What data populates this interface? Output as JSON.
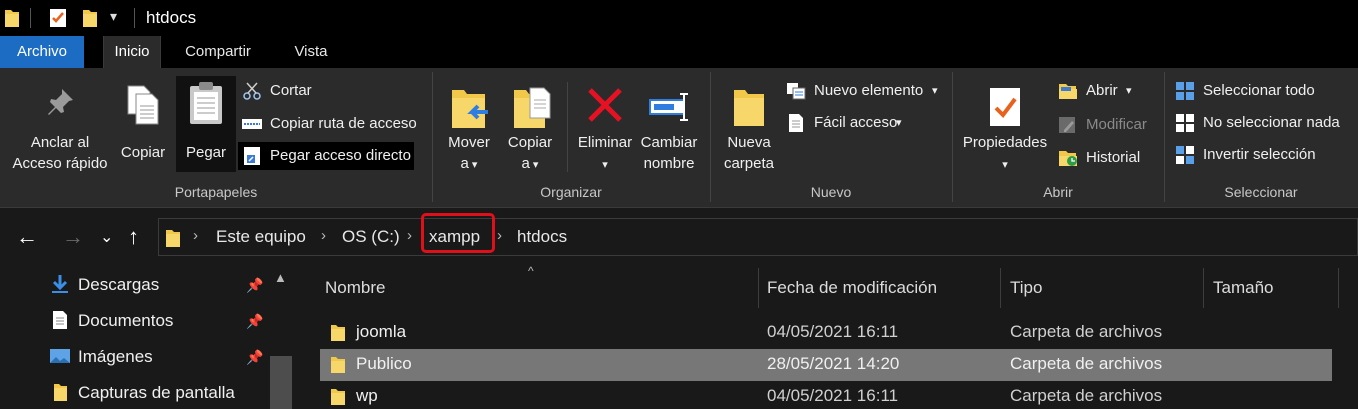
{
  "window": {
    "title": "htdocs"
  },
  "tabs": [
    {
      "label": "Archivo"
    },
    {
      "label": "Inicio"
    },
    {
      "label": "Compartir"
    },
    {
      "label": "Vista"
    }
  ],
  "ribbon": {
    "portapapeles": {
      "group_label": "Portapapeles",
      "pin": {
        "line1": "Anclar al",
        "line2": "Acceso rápido"
      },
      "copy": "Copiar",
      "paste": "Pegar",
      "cut": "Cortar",
      "copy_path": "Copiar ruta de acceso",
      "paste_shortcut": "Pegar acceso directo"
    },
    "organizar": {
      "group_label": "Organizar",
      "move": {
        "line1": "Mover",
        "line2": "a"
      },
      "copy_to": {
        "line1": "Copiar",
        "line2": "a"
      },
      "delete": "Eliminar",
      "rename": {
        "line1": "Cambiar",
        "line2": "nombre"
      }
    },
    "nuevo": {
      "group_label": "Nuevo",
      "new_folder": {
        "line1": "Nueva",
        "line2": "carpeta"
      },
      "new_item": "Nuevo elemento",
      "easy_access": "Fácil acceso"
    },
    "abrir": {
      "group_label": "Abrir",
      "properties": "Propiedades",
      "open": "Abrir",
      "edit": "Modificar",
      "history": "Historial"
    },
    "seleccionar": {
      "group_label": "Seleccionar",
      "select_all": "Seleccionar todo",
      "select_none": "No seleccionar nada",
      "invert": "Invertir selección"
    }
  },
  "address": {
    "crumbs": [
      "Este equipo",
      "OS (C:)",
      "xampp",
      "htdocs"
    ]
  },
  "navpane": {
    "items": [
      {
        "label": "Descargas",
        "icon": "download-arrow-icon",
        "pinned": true
      },
      {
        "label": "Documentos",
        "icon": "document-icon",
        "pinned": true
      },
      {
        "label": "Imágenes",
        "icon": "pictures-icon",
        "pinned": true
      },
      {
        "label": "Capturas de pantalla",
        "icon": "folder-icon",
        "pinned": false
      }
    ]
  },
  "filelist": {
    "columns": [
      "Nombre",
      "Fecha de modificación",
      "Tipo",
      "Tamaño"
    ],
    "rows": [
      {
        "name": "joomla",
        "date": "04/05/2021 16:11",
        "type": "Carpeta de archivos",
        "selected": false
      },
      {
        "name": "Publico",
        "date": "28/05/2021 14:20",
        "type": "Carpeta de archivos",
        "selected": true
      },
      {
        "name": "wp",
        "date": "04/05/2021 16:11",
        "type": "Carpeta de archivos",
        "selected": false
      }
    ]
  },
  "colors": {
    "file_tab": "#1c6cc4",
    "folder": "#f2c84b",
    "delete_red": "#e81123",
    "highlight_box": "#e0101a",
    "selected_row": "#777777"
  }
}
